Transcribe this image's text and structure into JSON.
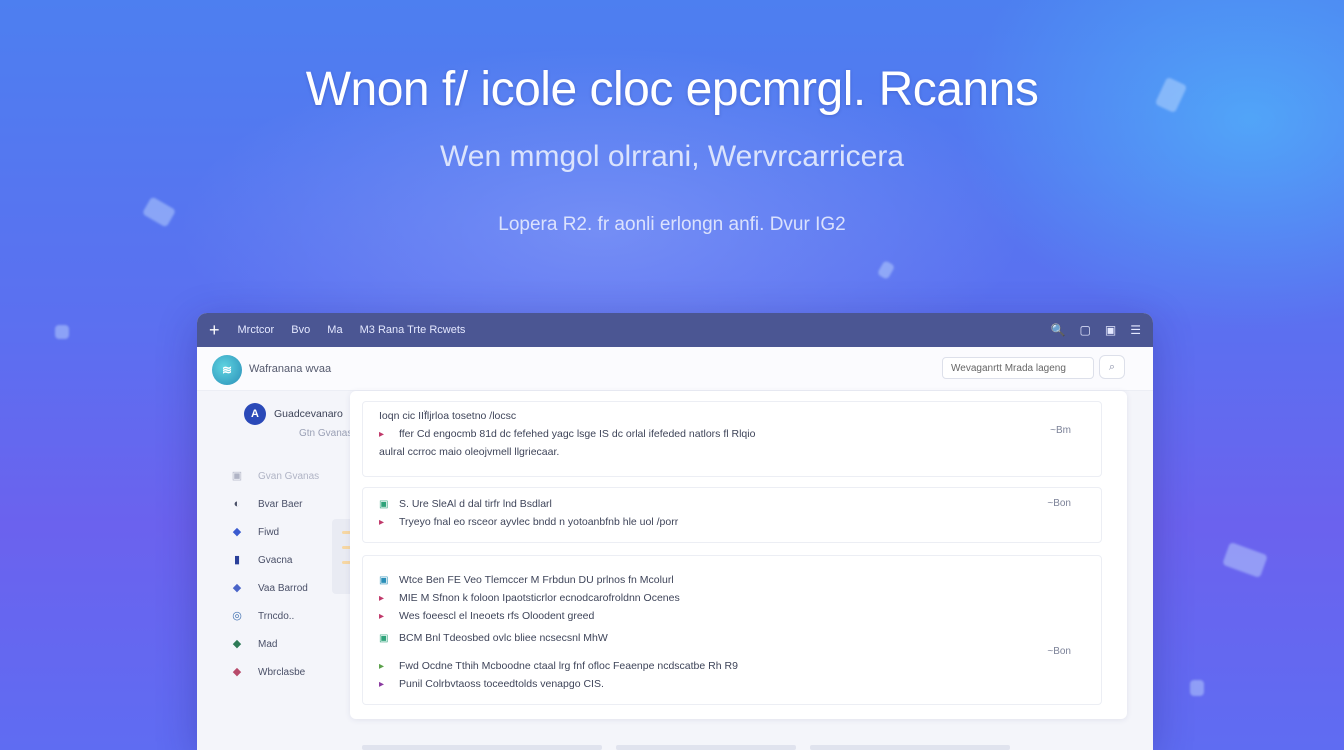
{
  "hero": {
    "title": "Wnon  f/ icole  cloc  epcmrgl. Rcanns",
    "subtitle": "Wen mmgol  olrrani,  Wervrcarricera",
    "tagline": "Lopera  R2.  fr aonli erlongn  anfi. Dvur IG2"
  },
  "window": {
    "titlebar": {
      "plus": "+",
      "menu": [
        "Mrctcor",
        "Bvo",
        "Ma",
        "M3 Rana  Trte Rcwets"
      ],
      "controls": [
        "🔍",
        "▢",
        "▣",
        "☰"
      ]
    },
    "header": {
      "logo": "≋",
      "app_name": "Wafranana  wvaa",
      "search_placeholder": "Wevaganrtt  Mrada  lageng",
      "search_button": "⌕"
    },
    "sidebar": {
      "head_badge": "A",
      "head_title": "Guadcevanaro",
      "head_sub": "Gtn Gvanas",
      "items": [
        {
          "icon": "▣",
          "label": "Gvan Gvanas",
          "faded": true
        },
        {
          "icon": "◐",
          "label": "Bvar Baer",
          "faded": false
        },
        {
          "icon": "◆",
          "label": "Fiwd",
          "faded": false
        },
        {
          "icon": "▮",
          "label": "Gvacna",
          "faded": false
        },
        {
          "icon": "◆",
          "label": "Vaa Barrod",
          "faded": false
        },
        {
          "icon": "◎",
          "label": "Trncdo..",
          "faded": false
        },
        {
          "icon": "◆",
          "label": "Mad",
          "faded": false
        },
        {
          "icon": "◆",
          "label": "Wbrclasbe",
          "faded": false
        }
      ]
    },
    "cards": [
      {
        "meta": "~Bm",
        "rows": [
          {
            "icon": "",
            "text": "Ioqn  cic  IIf̈ljrloa  tosetno /locsc"
          },
          {
            "icon": "▸",
            "text": "ffer  Cd  engocmb 81d dc fefehed yagc  lsge IS dc  orlal  ifefeded  natlors  fl  Rlqio"
          },
          {
            "icon": "",
            "text": "aulral  ccrroc  maio oleojvmell  llgriecaar."
          }
        ]
      },
      {
        "meta": "~Bon",
        "rows": [
          {
            "icon": "▣",
            "text": "S. Ure  SleAl  d  dal  tirfr  lnd  Bsdlarl"
          },
          {
            "icon": "▸",
            "text": "Tryeyo  fnal  eo rsceor  ayvlec bndd  n  yotoanbfnb  hle  uol  /porr"
          }
        ]
      },
      {
        "meta": "~Bon",
        "rows": [
          {
            "icon": "▣",
            "text": "Wtce  Ben  FE  Veo  Tlemccer  M  Frbdun  DU  prlnos  fn  Mcolurl"
          },
          {
            "icon": "▸",
            "text": "MIE  M  Sfnon  k  foloon  Ipaotsticrlor  ecnodcarofroldnn  Ocenes"
          },
          {
            "icon": "▸",
            "text": "Wes  foeescl  el  Ineoets rfs  Oloodent  greed"
          },
          {
            "icon": "▣",
            "text": "BCM  Bnl  Tdeosbed  ovlc  bliee  ncsecsnl  MhW"
          },
          {
            "icon": "▸",
            "text": "Fwd  Ocdne  Tthih  Mcboodne  ctaal  lrg  fnf  ofloc  Feaenpe  ncdscatbe  Rh  R9"
          },
          {
            "icon": "▸",
            "text": "Punil  Colrbvtaoss  toceedtolds  venapgo  CIS."
          }
        ]
      }
    ]
  },
  "colors": {
    "titlebar": "#4b5693",
    "accent": "#2a49b8",
    "background_top": "#4d7ff0",
    "background_bottom": "#6b62ee"
  }
}
